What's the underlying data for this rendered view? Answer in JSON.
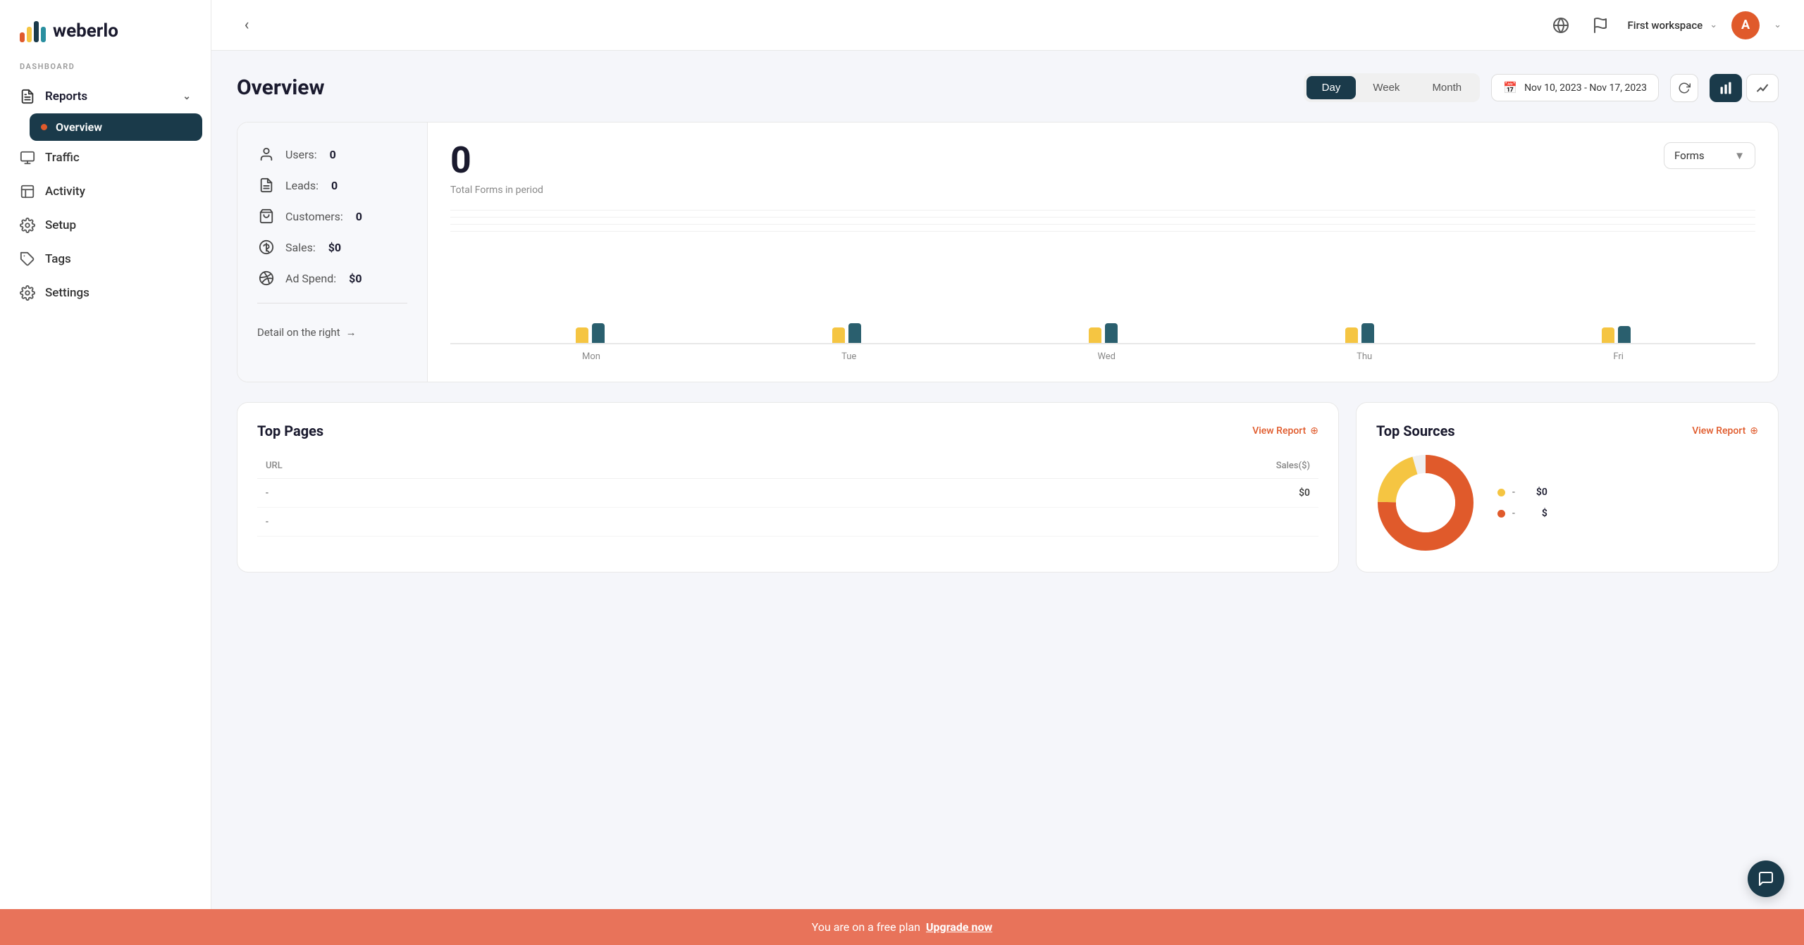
{
  "sidebar": {
    "logo_text": "weberlo",
    "dashboard_label": "DASHBOARD",
    "nav_items": [
      {
        "id": "reports",
        "label": "Reports",
        "icon": "📋",
        "has_sub": true,
        "expanded": true
      },
      {
        "id": "traffic",
        "label": "Traffic",
        "icon": "📊"
      },
      {
        "id": "activity",
        "label": "Activity",
        "icon": "⌚"
      },
      {
        "id": "setup",
        "label": "Setup",
        "icon": "🔧"
      },
      {
        "id": "tags",
        "label": "Tags",
        "icon": "🏷"
      },
      {
        "id": "settings",
        "label": "Settings",
        "icon": "⚙️"
      }
    ],
    "sub_items": [
      {
        "id": "overview",
        "label": "Overview",
        "active": true
      }
    ]
  },
  "header": {
    "workspace_name": "First workspace",
    "avatar_letter": "A"
  },
  "overview": {
    "title": "Overview",
    "period_tabs": [
      {
        "id": "day",
        "label": "Day",
        "active": true
      },
      {
        "id": "week",
        "label": "Week",
        "active": false
      },
      {
        "id": "month",
        "label": "Month",
        "active": false
      }
    ],
    "date_range": "Nov 10, 2023 - Nov 17, 2023",
    "chart_dropdown": "Forms",
    "chart_dropdown_arrow": "▼",
    "total_value": "0",
    "total_label": "Total Forms in period"
  },
  "stats": {
    "items": [
      {
        "id": "users",
        "label": "Users:",
        "value": "0",
        "icon": "👤"
      },
      {
        "id": "leads",
        "label": "Leads:",
        "value": "0",
        "icon": "📋"
      },
      {
        "id": "customers",
        "label": "Customers:",
        "value": "0",
        "icon": "🛒"
      },
      {
        "id": "sales",
        "label": "Sales:",
        "value": "$0",
        "icon": "💲"
      },
      {
        "id": "adspend",
        "label": "Ad Spend:",
        "value": "$0",
        "icon": "🎯"
      }
    ],
    "detail_link": "Detail on the right",
    "detail_arrow": "→"
  },
  "chart": {
    "days": [
      "Mon",
      "Tue",
      "Wed",
      "Thu",
      "Fri"
    ],
    "bars": [
      {
        "day": "Mon",
        "yellow": 18,
        "teal": 22
      },
      {
        "day": "Tue",
        "yellow": 18,
        "teal": 22
      },
      {
        "day": "Wed",
        "yellow": 18,
        "teal": 22
      },
      {
        "day": "Thu",
        "yellow": 18,
        "teal": 22
      },
      {
        "day": "Fri",
        "yellow": 18,
        "teal": 20
      }
    ]
  },
  "top_pages": {
    "title": "Top Pages",
    "view_report": "View Report",
    "columns": [
      "URL",
      "Sales($)"
    ],
    "rows": [
      {
        "url": "-",
        "sales": "$0"
      },
      {
        "url": "-",
        "sales": ""
      }
    ]
  },
  "top_sources": {
    "title": "Top Sources",
    "view_report": "View Report",
    "legend": [
      {
        "color": "#f5c542",
        "label": "-",
        "value": "$0"
      },
      {
        "color": "#e05a2b",
        "label": "-",
        "value": "$"
      }
    ]
  },
  "banner": {
    "text": "You are on a free plan",
    "upgrade_label": "Upgrade now"
  },
  "colors": {
    "accent": "#e05a2b",
    "dark_nav": "#1a3a4a",
    "yellow": "#f5c542"
  }
}
